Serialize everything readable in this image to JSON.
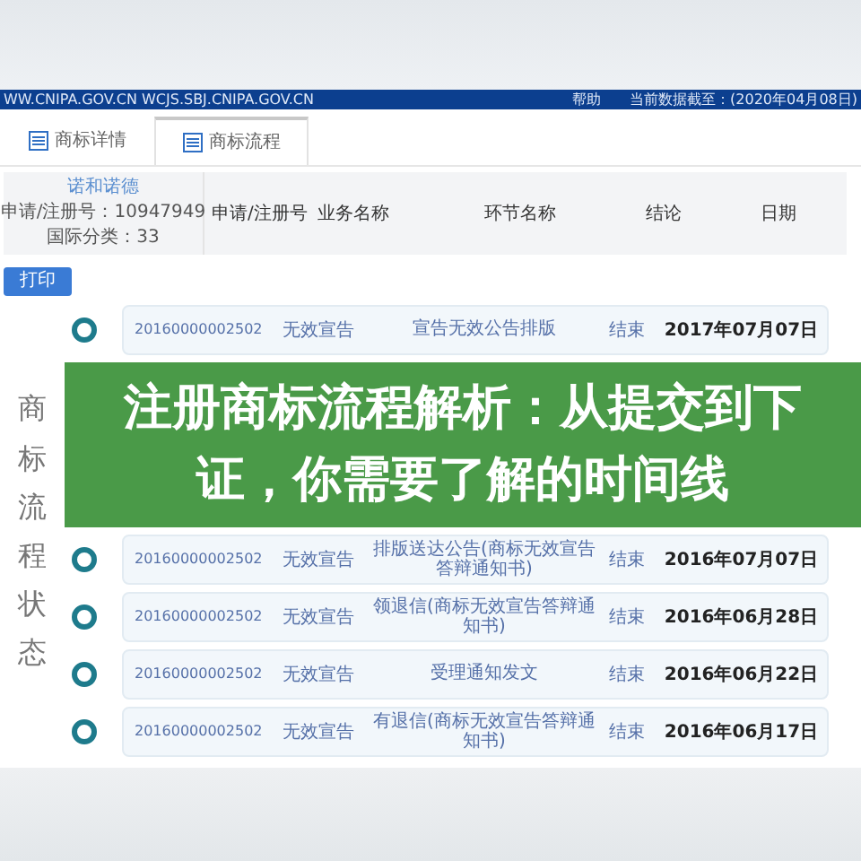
{
  "top_bar": {
    "url": "WW.CNIPA.GOV.CN WCJS.SBJ.CNIPA.GOV.CN",
    "help": "帮助",
    "data_date": "当前数据截至：(2020年04月08日)"
  },
  "tabs": [
    {
      "label": "商标详情",
      "selected": false
    },
    {
      "label": "商标流程",
      "selected": true
    }
  ],
  "summary": {
    "applicant": "诺和诺德",
    "reg_no": "申请/注册号：10947949",
    "class": "国际分类：33"
  },
  "columns": [
    "申请/注册号",
    "业务名称",
    "环节名称",
    "结论",
    "日期"
  ],
  "print_button": "打印",
  "side_label": "商标流程状态",
  "rows": [
    {
      "number": "20160000002502",
      "business": "无效宣告",
      "step": "宣告无效公告排版",
      "result": "结束",
      "date": "2017年07月07日"
    },
    {
      "number": "20160000002502",
      "business": "无效宣告",
      "step": "排版送达公告(商标无效宣告答辩通知书)",
      "result": "结束",
      "date": "2016年07月07日"
    },
    {
      "number": "20160000002502",
      "business": "无效宣告",
      "step": "领退信(商标无效宣告答辩通知书)",
      "result": "结束",
      "date": "2016年06月28日"
    },
    {
      "number": "20160000002502",
      "business": "无效宣告",
      "step": "受理通知发文",
      "result": "结束",
      "date": "2016年06月22日"
    },
    {
      "number": "20160000002502",
      "business": "无效宣告",
      "step": "有退信(商标无效宣告答辩通知书)",
      "result": "结束",
      "date": "2016年06月17日"
    }
  ],
  "banner": {
    "title": "注册商标流程解析：从提交到下证，你需要了解的时间线"
  }
}
